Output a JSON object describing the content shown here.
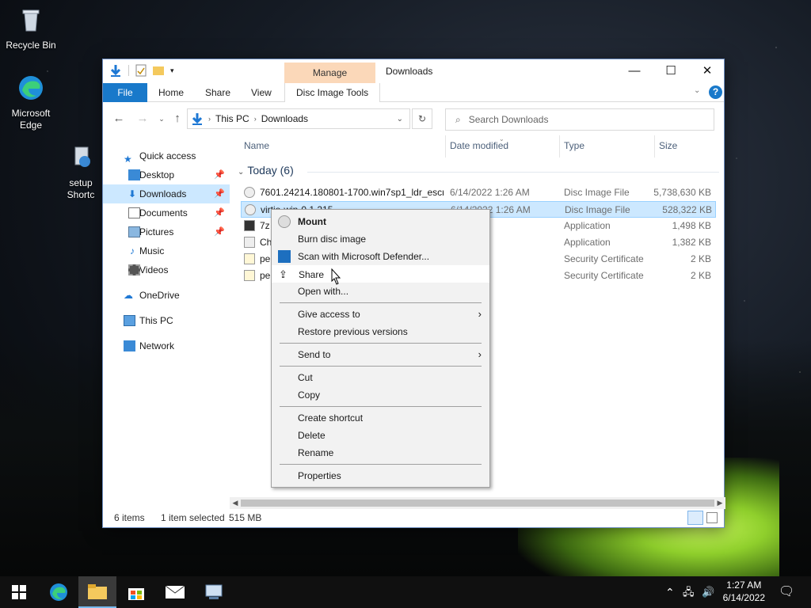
{
  "desktop": {
    "icons": [
      {
        "label": "Recycle Bin"
      },
      {
        "label": "Microsoft Edge"
      },
      {
        "label": "setup Shortc"
      }
    ]
  },
  "window": {
    "title": "Downloads",
    "manage_tab": "Manage",
    "ribbon_tabs": [
      "File",
      "Home",
      "Share",
      "View",
      "Disc Image Tools"
    ],
    "controls": {
      "minimize": "—",
      "maximize": "☐",
      "close": "✕"
    }
  },
  "address": {
    "crumbs": [
      "This PC",
      "Downloads"
    ],
    "search_placeholder": "Search Downloads"
  },
  "nav_pane": {
    "quick_access": "Quick access",
    "pinned": [
      {
        "label": "Desktop",
        "pinned": true
      },
      {
        "label": "Downloads",
        "pinned": true,
        "selected": true
      },
      {
        "label": "Documents",
        "pinned": true
      },
      {
        "label": "Pictures",
        "pinned": true
      },
      {
        "label": "Music",
        "pinned": false
      },
      {
        "label": "Videos",
        "pinned": false
      }
    ],
    "onedrive": "OneDrive",
    "this_pc": "This PC",
    "network": "Network"
  },
  "columns": {
    "name": "Name",
    "date": "Date modified",
    "type": "Type",
    "size": "Size"
  },
  "group_label": "Today (6)",
  "files": [
    {
      "name": "7601.24214.180801-1700.win7sp1_ldr_escr...",
      "date": "6/14/2022 1:26 AM",
      "type": "Disc Image File",
      "size": "5,738,630 KB",
      "selected": false
    },
    {
      "name": "virtio-win-0.1.215",
      "date": "6/14/2022 1:26 AM",
      "type": "Disc Image File",
      "size": "528,322 KB",
      "selected": true
    },
    {
      "name": "7z",
      "date": "1:26 AM",
      "type": "Application",
      "size": "1,498 KB",
      "selected": false
    },
    {
      "name": "Ch",
      "date": "1:26 AM",
      "type": "Application",
      "size": "1,382 KB",
      "selected": false
    },
    {
      "name": "pe",
      "date": "1:19 AM",
      "type": "Security Certificate",
      "size": "2 KB",
      "selected": false
    },
    {
      "name": "pe",
      "date": "1:18 AM",
      "type": "Security Certificate",
      "size": "2 KB",
      "selected": false
    }
  ],
  "status": {
    "items": "6 items",
    "selected": "1 item selected",
    "size": "515 MB"
  },
  "context_menu": {
    "groups": [
      [
        {
          "label": "Mount",
          "bold": true,
          "icon": "disc-icon"
        },
        {
          "label": "Burn disc image"
        },
        {
          "label": "Scan with Microsoft Defender...",
          "icon": "defender-icon"
        },
        {
          "label": "Share",
          "icon": "share-icon",
          "hover": true
        },
        {
          "label": "Open with..."
        }
      ],
      [
        {
          "label": "Give access to",
          "submenu": true
        },
        {
          "label": "Restore previous versions"
        }
      ],
      [
        {
          "label": "Send to",
          "submenu": true
        }
      ],
      [
        {
          "label": "Cut"
        },
        {
          "label": "Copy"
        }
      ],
      [
        {
          "label": "Create shortcut"
        },
        {
          "label": "Delete"
        },
        {
          "label": "Rename"
        }
      ],
      [
        {
          "label": "Properties"
        }
      ]
    ]
  },
  "taskbar": {
    "time": "1:27 AM",
    "date": "6/14/2022"
  }
}
